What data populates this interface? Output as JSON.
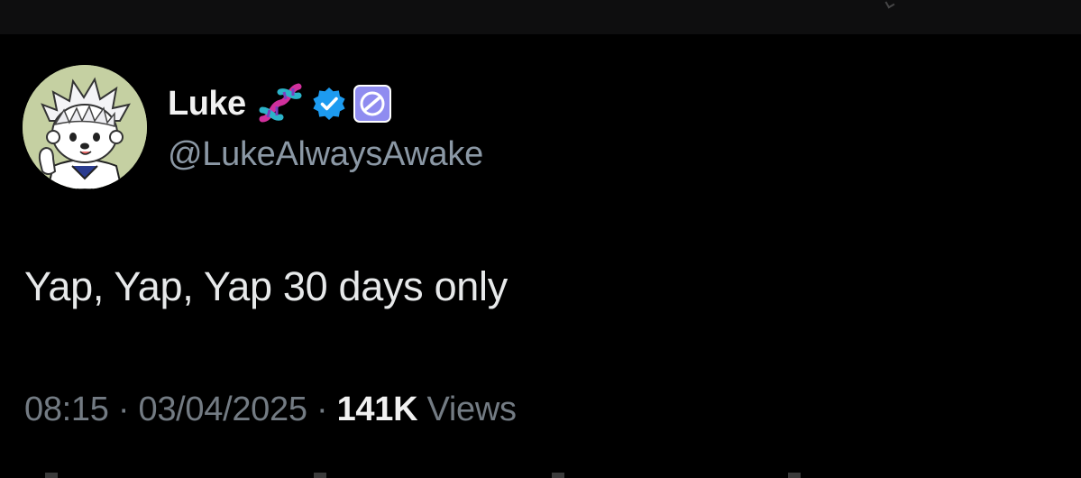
{
  "tweet": {
    "author": {
      "display_name": "Luke",
      "handle": "@LukeAlwaysAwake",
      "avatar": "anime-character-avatar",
      "badges": [
        "dna-emoji-icon",
        "verified-checkmark-icon",
        "affiliate-badge-icon"
      ]
    },
    "text": "Yap, Yap, Yap 30 days only",
    "time": "08:15",
    "separator": "·",
    "date": "03/04/2025",
    "views_count": "141K",
    "views_label": "Views"
  },
  "colors": {
    "background": "#000000",
    "primary_text": "#e7e9ea",
    "secondary_text": "#8b98a5",
    "verified_blue": "#1d9bf0",
    "affiliate_purple": "#8f8cf0"
  }
}
